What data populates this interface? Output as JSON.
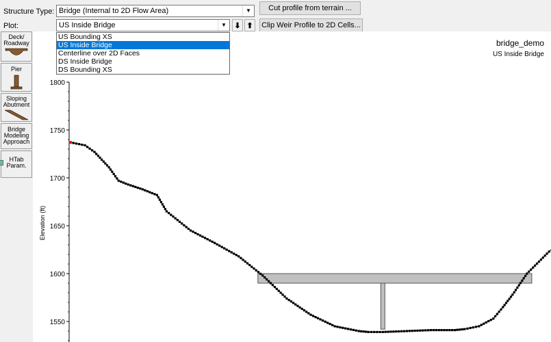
{
  "toolbar": {
    "structure_type_label": "Structure Type:",
    "structure_type_value": "Bridge (Internal to 2D Flow Area)",
    "plot_label": "Plot:",
    "plot_value": "US Inside Bridge",
    "cut_profile_button": "Cut profile from terrain ...",
    "clip_weir_button": "Clip Weir Profile to 2D Cells...",
    "move_down_glyph": "⬇",
    "move_up_glyph": "⬆",
    "dropdown_arrow_glyph": "▼"
  },
  "plot_dropdown": {
    "options": [
      "US Bounding XS",
      "US Inside Bridge",
      "Centerline over 2D Faces",
      "DS Inside Bridge",
      "DS Bounding XS"
    ],
    "selected_index": 1
  },
  "sidebar": {
    "deck": [
      "Deck/",
      "Roadway"
    ],
    "pier": [
      "Pier"
    ],
    "sloping": [
      "Sloping",
      "Abutment"
    ],
    "modeling": [
      "Bridge",
      "Modeling",
      "Approach"
    ],
    "htab": [
      "HTab",
      "Param."
    ]
  },
  "chart_data": {
    "type": "line",
    "title": "bridge_demo",
    "subtitle": "US Inside Bridge",
    "xlabel": "",
    "ylabel": "Elevation (ft)",
    "yticks": [
      1550,
      1600,
      1650,
      1700,
      1750,
      1800
    ],
    "ylim": [
      1530,
      1800
    ],
    "grid": false,
    "colors": {
      "terrain": "#000000",
      "deck": "#c0c0c0",
      "start_marker": "#ff0000"
    },
    "terrain_profile": {
      "x": [
        0,
        3,
        5,
        8,
        10,
        12,
        15,
        18,
        20,
        25,
        30,
        35,
        40,
        45,
        50,
        55,
        60,
        62,
        65,
        70,
        75,
        80,
        82,
        85,
        88,
        90,
        92,
        95,
        100
      ],
      "y": [
        1737,
        1734,
        1727,
        1711,
        1697,
        1693,
        1688,
        1682,
        1665,
        1645,
        1632,
        1618,
        1598,
        1574,
        1557,
        1545,
        1540,
        1539,
        1539,
        1540,
        1541,
        1541,
        1542,
        1545,
        1553,
        1565,
        1578,
        1600,
        1625
      ]
    },
    "bridge_deck": {
      "x_start": 39,
      "x_end": 96,
      "high_chord": 1600,
      "low_chord": 1590
    },
    "pier": {
      "x_center": 65,
      "top": 1590,
      "bottom": 1542
    }
  }
}
